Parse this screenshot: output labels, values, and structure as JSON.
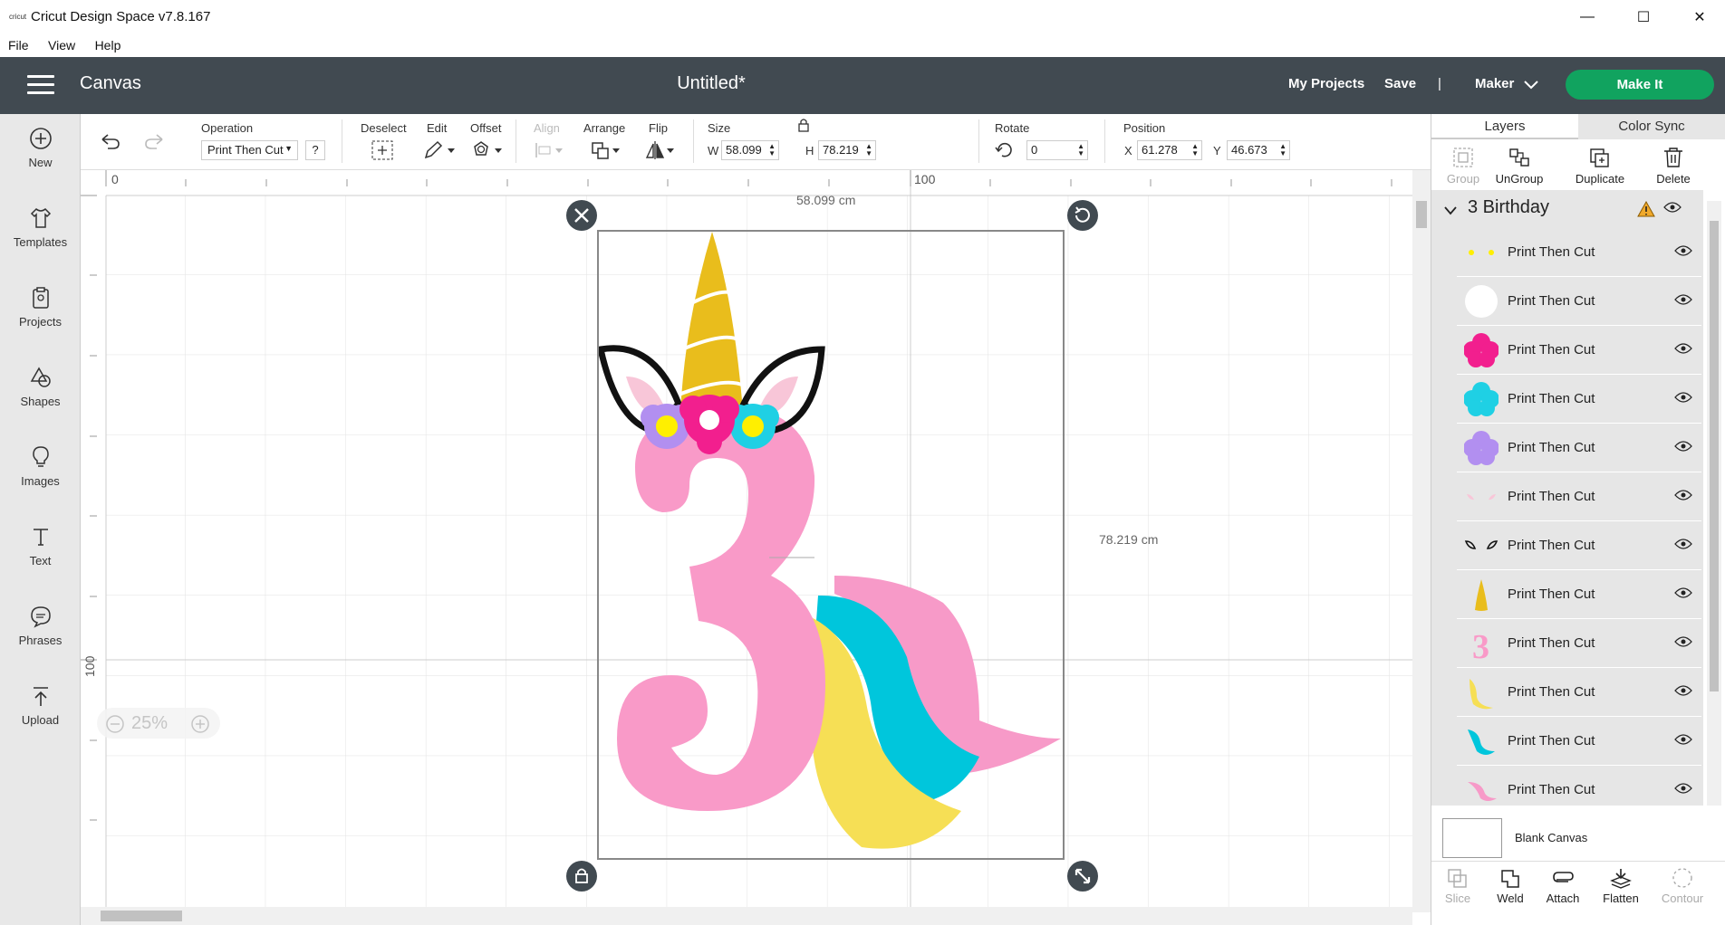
{
  "window": {
    "logo_text": "cricut",
    "title": "Cricut Design Space  v7.8.167",
    "minimize": "—",
    "maximize": "☐",
    "close": "✕"
  },
  "menu": [
    "File",
    "View",
    "Help"
  ],
  "header": {
    "canvas_label": "Canvas",
    "doc_title": "Untitled*",
    "my_projects": "My Projects",
    "save": "Save",
    "divider": "|",
    "machine": "Maker",
    "make_it": "Make It",
    "accent": "#11a35f",
    "bg": "#414a51"
  },
  "left_nav": [
    {
      "label": "New",
      "icon": "plus-circle-icon"
    },
    {
      "label": "Templates",
      "icon": "shirt-icon"
    },
    {
      "label": "Projects",
      "icon": "clipboard-icon"
    },
    {
      "label": "Shapes",
      "icon": "shapes-icon"
    },
    {
      "label": "Images",
      "icon": "lightbulb-icon"
    },
    {
      "label": "Text",
      "icon": "text-icon"
    },
    {
      "label": "Phrases",
      "icon": "speech-bubble-icon"
    },
    {
      "label": "Upload",
      "icon": "upload-icon"
    }
  ],
  "toolbar": {
    "operation_label": "Operation",
    "operation_value": "Print Then Cut",
    "help": "?",
    "deselect": "Deselect",
    "edit": "Edit",
    "offset": "Offset",
    "align": "Align",
    "arrange": "Arrange",
    "flip": "Flip",
    "size_label": "Size",
    "w_label": "W",
    "w_value": "58.099",
    "h_label": "H",
    "h_value": "78.219",
    "rotate_label": "Rotate",
    "rotate_value": "0",
    "position_label": "Position",
    "x_label": "X",
    "x_value": "61.278",
    "y_label": "Y",
    "y_value": "46.673"
  },
  "canvas": {
    "ruler_top": [
      "0",
      "100"
    ],
    "ruler_left": [
      "100"
    ],
    "width_readout": "58.099 cm",
    "height_readout": "78.219 cm",
    "zoom": "25%"
  },
  "right_panel": {
    "tabs": [
      "Layers",
      "Color Sync"
    ],
    "tools": [
      {
        "label": "Group",
        "enabled": false
      },
      {
        "label": "UnGroup",
        "enabled": true
      },
      {
        "label": "Duplicate",
        "enabled": true
      },
      {
        "label": "Delete",
        "enabled": true
      }
    ],
    "group_name": "3 Birthday",
    "layers": [
      {
        "label": "Print Then Cut",
        "thumb": "yellow-dots"
      },
      {
        "label": "Print Then Cut",
        "thumb": "white-circle"
      },
      {
        "label": "Print Then Cut",
        "thumb": "pink-flower"
      },
      {
        "label": "Print Then Cut",
        "thumb": "cyan-flower"
      },
      {
        "label": "Print Then Cut",
        "thumb": "purple-flower"
      },
      {
        "label": "Print Then Cut",
        "thumb": "pink-ears"
      },
      {
        "label": "Print Then Cut",
        "thumb": "black-ears"
      },
      {
        "label": "Print Then Cut",
        "thumb": "gold-horn"
      },
      {
        "label": "Print Then Cut",
        "thumb": "pink-three"
      },
      {
        "label": "Print Then Cut",
        "thumb": "yellow-mane"
      },
      {
        "label": "Print Then Cut",
        "thumb": "cyan-mane"
      },
      {
        "label": "Print Then Cut",
        "thumb": "pink-mane"
      }
    ],
    "blank_canvas": "Blank Canvas",
    "bottom_tools": [
      {
        "label": "Slice",
        "enabled": false
      },
      {
        "label": "Weld",
        "enabled": true
      },
      {
        "label": "Attach",
        "enabled": true
      },
      {
        "label": "Flatten",
        "enabled": true
      },
      {
        "label": "Contour",
        "enabled": false
      }
    ]
  }
}
